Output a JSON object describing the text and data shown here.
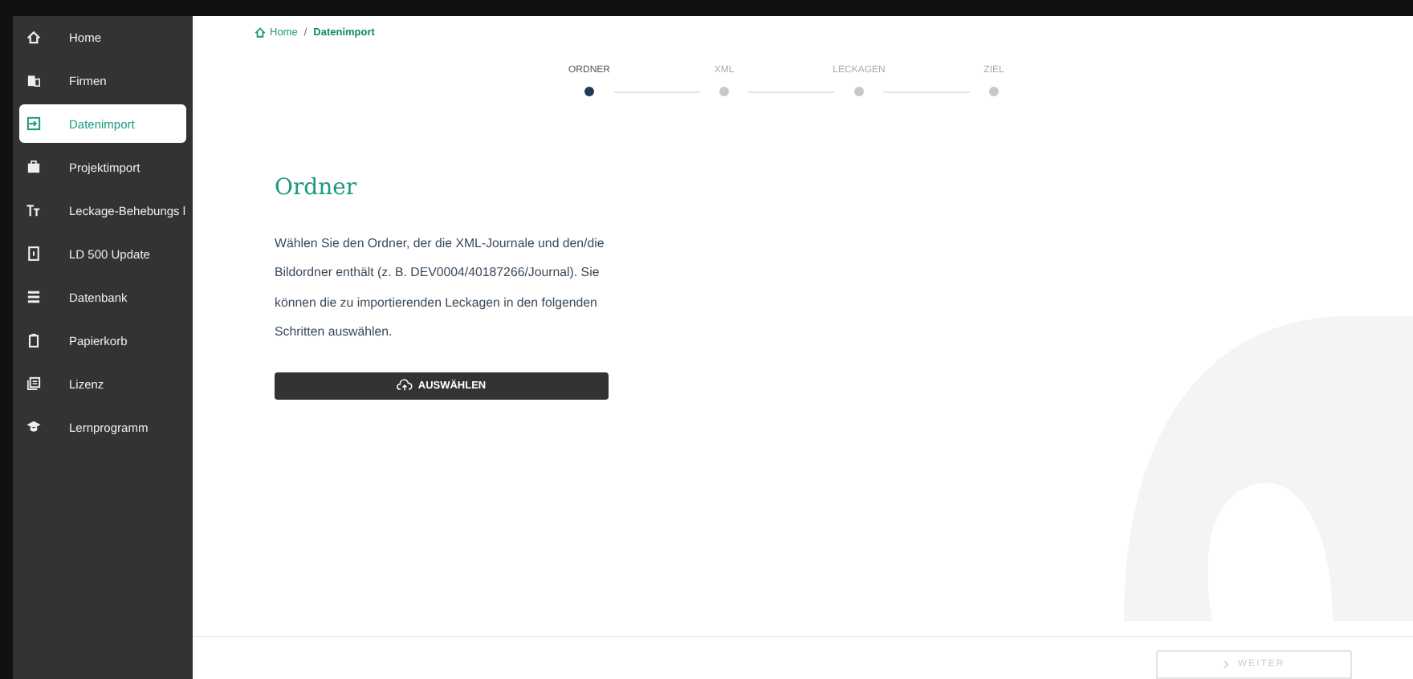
{
  "sidebar": {
    "items": [
      {
        "label": "Home",
        "selected": false
      },
      {
        "label": "Firmen",
        "selected": false
      },
      {
        "label": "Datenimport",
        "selected": true
      },
      {
        "label": "Projektimport",
        "selected": false
      },
      {
        "label": "Leckage-Behebungs l",
        "selected": false
      },
      {
        "label": "LD 500 Update",
        "selected": false
      },
      {
        "label": "Datenbank",
        "selected": false
      },
      {
        "label": "Papierkorb",
        "selected": false
      },
      {
        "label": "Lizenz",
        "selected": false
      },
      {
        "label": "Lernprogramm",
        "selected": false
      }
    ]
  },
  "breadcrumb": [
    {
      "label": "Home"
    },
    {
      "label": "Datenimport"
    }
  ],
  "breadcrumb_separator": "/",
  "stepper": [
    {
      "label": "ORDNER",
      "selected": true
    },
    {
      "label": "XML",
      "selected": false
    },
    {
      "label": "LECKAGEN",
      "selected": false
    },
    {
      "label": "ZIEL",
      "selected": false
    }
  ],
  "title": "Ordner",
  "description": "Wählen Sie den Ordner, der die XML-Journale und den/die Bildordner enthält (z. B. DEV0004/40187266/Journal). Sie können die zu importierenden Leckagen in den folgenden Schritten auswählen.",
  "select_button": "AUSWÄHLEN",
  "next_button": {
    "label": "WEITER",
    "disabled": true
  }
}
